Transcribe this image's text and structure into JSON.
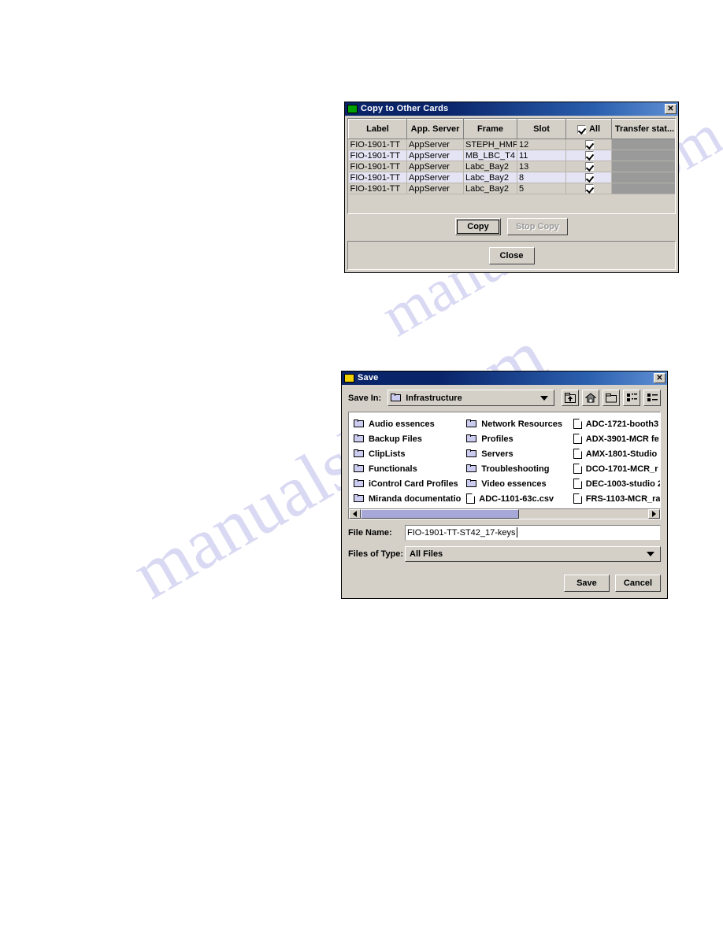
{
  "watermark": {
    "line1": "manualslib.com",
    "line2": "manualslib.com"
  },
  "copy_dialog": {
    "title": "Copy to Other Cards",
    "title_icon": "card-icon",
    "close_label": "✕",
    "columns": [
      "Label",
      "App. Server",
      "Frame",
      "Slot",
      "All",
      "Transfer stat..."
    ],
    "header_all_checked": true,
    "rows": [
      {
        "label": "FIO-1901-TT",
        "app_server": "AppServer",
        "frame": "STEPH_HMP",
        "slot": "12",
        "checked": true,
        "status": ""
      },
      {
        "label": "FIO-1901-TT",
        "app_server": "AppServer",
        "frame": "MB_LBC_T4",
        "slot": "11",
        "checked": true,
        "status": ""
      },
      {
        "label": "FIO-1901-TT",
        "app_server": "AppServer",
        "frame": "Labc_Bay2",
        "slot": "13",
        "checked": true,
        "status": ""
      },
      {
        "label": "FIO-1901-TT",
        "app_server": "AppServer",
        "frame": "Labc_Bay2",
        "slot": "8",
        "checked": true,
        "status": ""
      },
      {
        "label": "FIO-1901-TT",
        "app_server": "AppServer",
        "frame": "Labc_Bay2",
        "slot": "5",
        "checked": true,
        "status": ""
      }
    ],
    "buttons": {
      "copy": "Copy",
      "stop_copy": "Stop Copy",
      "stop_copy_disabled": true,
      "close": "Close"
    }
  },
  "save_dialog": {
    "title": "Save",
    "title_icon": "save-icon",
    "close_label": "✕",
    "save_in_label": "Save In:",
    "save_in_value": "Infrastructure",
    "toolbar_icons": [
      "up-folder-icon",
      "home-icon",
      "new-folder-icon",
      "grid-view-icon",
      "list-view-icon"
    ],
    "columns": [
      [
        {
          "name": "Audio essences",
          "type": "folder"
        },
        {
          "name": "Backup Files",
          "type": "folder"
        },
        {
          "name": "ClipLists",
          "type": "folder"
        },
        {
          "name": "Functionals",
          "type": "folder"
        },
        {
          "name": "iControl Card Profiles",
          "type": "folder"
        },
        {
          "name": "Miranda documentation",
          "type": "folder"
        }
      ],
      [
        {
          "name": "Network Resources",
          "type": "folder"
        },
        {
          "name": "Profiles",
          "type": "folder"
        },
        {
          "name": "Servers",
          "type": "folder"
        },
        {
          "name": "Troubleshooting",
          "type": "folder"
        },
        {
          "name": "Video essences",
          "type": "folder"
        },
        {
          "name": "ADC-1101-63c.csv",
          "type": "file"
        }
      ],
      [
        {
          "name": "ADC-1721-booth3",
          "type": "file"
        },
        {
          "name": "ADX-3901-MCR fe",
          "type": "file"
        },
        {
          "name": "AMX-1801-Studio",
          "type": "file"
        },
        {
          "name": "DCO-1701-MCR_r",
          "type": "file"
        },
        {
          "name": "DEC-1003-studio 2",
          "type": "file"
        },
        {
          "name": "FRS-1103-MCR_ra",
          "type": "file"
        }
      ]
    ],
    "file_name_label": "File Name:",
    "file_name_value": "FIO-1901-TT-ST42_17-keys",
    "files_of_type_label": "Files of Type:",
    "files_of_type_value": "All Files",
    "buttons": {
      "save": "Save",
      "cancel": "Cancel"
    }
  }
}
